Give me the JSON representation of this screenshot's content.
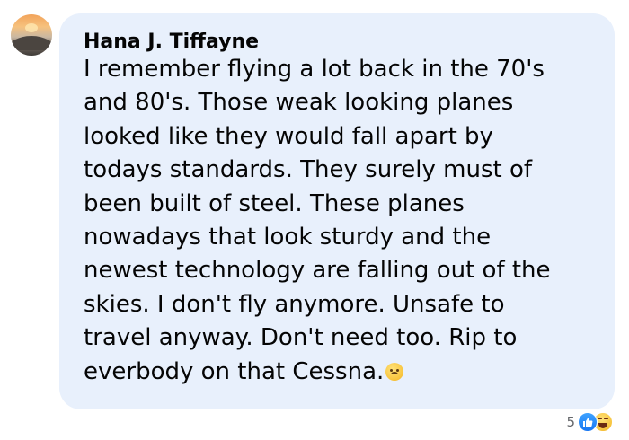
{
  "comment": {
    "author": "Hana J. Tiffayne",
    "lines": [
      "I remember flying a lot back in the 70's",
      "and 80's. Those weak looking planes",
      "looked like they would fall apart by",
      "todays standards. They surely must of",
      "been built of steel. These planes",
      "nowadays that look sturdy and the",
      "newest technology are falling out of the",
      "skies. I don't fly anymore. Unsafe to",
      "travel anyway. Don't need too. Rip to",
      "everbody on that Cessna."
    ],
    "trailing_emoji": "sad-face-emoji"
  },
  "reactions": {
    "count": "5",
    "types": [
      "like-icon",
      "haha-icon"
    ]
  },
  "colors": {
    "bubble_background": "#e8f0fc",
    "text": "#050505",
    "meta_text": "#65676b",
    "like_blue": "#1877f2"
  }
}
